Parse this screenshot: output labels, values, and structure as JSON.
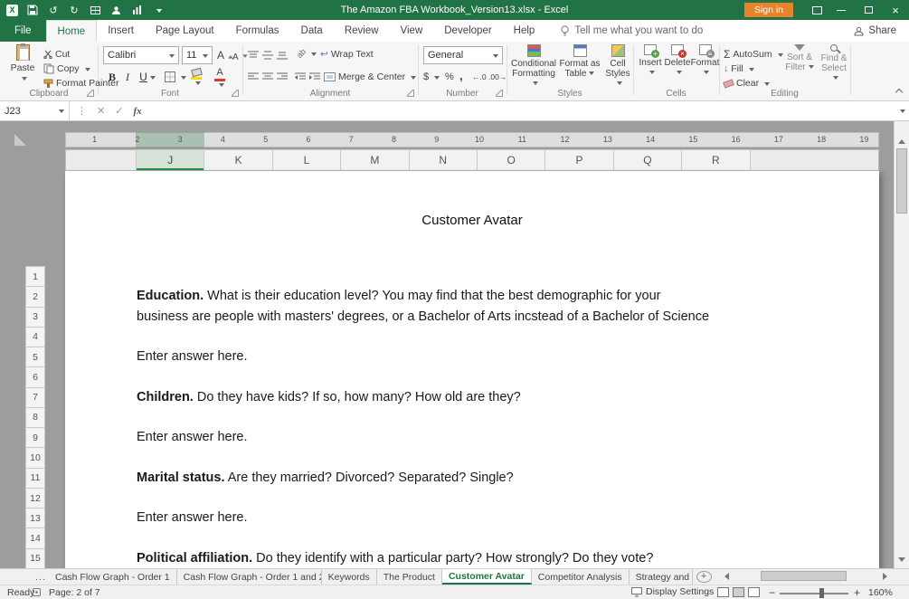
{
  "colors": {
    "excel_green": "#217346",
    "sign_in_orange": "#E8832C",
    "selection_green": "#1E8F50"
  },
  "titlebar": {
    "title": "The Amazon FBA Workbook_Version13.xlsx - Excel",
    "sign_in": "Sign in"
  },
  "icons": {
    "logo": "X",
    "undo": "↺",
    "redo": "↻",
    "close": "×",
    "dots": "⋮",
    "cancel": "✕",
    "check": "✓",
    "fx": "fx",
    "sigma": "Σ",
    "currency": "$",
    "percent": "%",
    "comma": ",",
    "increase_decimal": "←.0",
    "decrease_decimal": ".00→",
    "orientation": "ab",
    "font_grow": "A",
    "font_shrink": "A",
    "font_color": "A",
    "wrap_arrow": "↩",
    "fill_down": "↓",
    "ellipsis": "...",
    "add_sheet": "+",
    "zoom_out": "−",
    "zoom_in": "+"
  },
  "ribbon": {
    "file_tab": "File",
    "tabs": [
      {
        "label": "Home",
        "active": true
      },
      {
        "label": "Insert"
      },
      {
        "label": "Page Layout"
      },
      {
        "label": "Formulas"
      },
      {
        "label": "Data"
      },
      {
        "label": "Review"
      },
      {
        "label": "View"
      },
      {
        "label": "Developer"
      },
      {
        "label": "Help"
      }
    ],
    "tell_me": "Tell me what you want to do",
    "share": "Share",
    "groups": {
      "clipboard": {
        "label": "Clipboard",
        "paste": "Paste",
        "cut": "Cut",
        "copy": "Copy",
        "format_painter": "Format Painter"
      },
      "font": {
        "label": "Font",
        "name": "Calibri",
        "size": "11",
        "bold": "B",
        "italic": "I",
        "underline": "U"
      },
      "alignment": {
        "label": "Alignment",
        "wrap": "Wrap Text",
        "merge": "Merge & Center"
      },
      "number": {
        "label": "Number",
        "format": "General"
      },
      "styles": {
        "label": "Styles",
        "cond1": "Conditional",
        "cond2": "Formatting",
        "fat1": "Format as",
        "fat2": "Table",
        "cs1": "Cell",
        "cs2": "Styles"
      },
      "cells": {
        "label": "Cells",
        "insert": "Insert",
        "delete": "Delete",
        "format": "Format"
      },
      "editing": {
        "label": "Editing",
        "autosum": "AutoSum",
        "fill": "Fill",
        "clear": "Clear",
        "sort1": "Sort &",
        "sort2": "Filter",
        "find1": "Find &",
        "find2": "Select"
      }
    }
  },
  "formula_bar": {
    "name_box": "J23",
    "value": ""
  },
  "ruler": {
    "marks": [
      "1",
      "2",
      "3",
      "4",
      "5",
      "6",
      "7",
      "8",
      "9",
      "10",
      "11",
      "12",
      "13",
      "14",
      "15",
      "16",
      "17",
      "18",
      "19"
    ]
  },
  "sheet": {
    "columns": [
      {
        "label": "J",
        "selected": true
      },
      {
        "label": "K"
      },
      {
        "label": "L"
      },
      {
        "label": "M"
      },
      {
        "label": "N"
      },
      {
        "label": "O"
      },
      {
        "label": "P"
      },
      {
        "label": "Q"
      },
      {
        "label": "R"
      }
    ],
    "title": "Customer Avatar",
    "rows": [
      {
        "num": "1",
        "bold": "",
        "text": ""
      },
      {
        "num": "2",
        "bold": "Education.",
        "text": " What is their education level? You may find that the best demographic for your"
      },
      {
        "num": "3",
        "bold": "",
        "text": "business are people with masters' degrees, or a Bachelor of Arts incstead of a Bachelor of Science"
      },
      {
        "num": "4",
        "bold": "",
        "text": ""
      },
      {
        "num": "5",
        "bold": "",
        "text": "Enter answer here."
      },
      {
        "num": "6",
        "bold": "",
        "text": ""
      },
      {
        "num": "7",
        "bold": "Children.",
        "text": " Do they have kids? If so, how many? How old are they?"
      },
      {
        "num": "8",
        "bold": "",
        "text": ""
      },
      {
        "num": "9",
        "bold": "",
        "text": "Enter answer here."
      },
      {
        "num": "10",
        "bold": "",
        "text": ""
      },
      {
        "num": "11",
        "bold": "Marital status.",
        "text": " Are they married? Divorced? Separated? Single?"
      },
      {
        "num": "12",
        "bold": "",
        "text": ""
      },
      {
        "num": "13",
        "bold": "",
        "text": "Enter answer here."
      },
      {
        "num": "14",
        "bold": "",
        "text": ""
      },
      {
        "num": "15",
        "bold": "Political affiliation.",
        "text": " Do they identify with a particular party? How strongly? Do they vote?"
      }
    ]
  },
  "sheet_tabs": {
    "tabs": [
      {
        "label": "Cash Flow Graph - Order 1"
      },
      {
        "label": "Cash Flow Graph - Order 1 and 2"
      },
      {
        "label": "Keywords"
      },
      {
        "label": "The Product"
      },
      {
        "label": "Customer Avatar",
        "active": true
      },
      {
        "label": "Competitor Analysis"
      },
      {
        "label": "Strategy and"
      }
    ]
  },
  "status_bar": {
    "ready": "Ready",
    "page": "Page: 2 of 7",
    "display_settings": "Display Settings",
    "zoom": "160%"
  }
}
